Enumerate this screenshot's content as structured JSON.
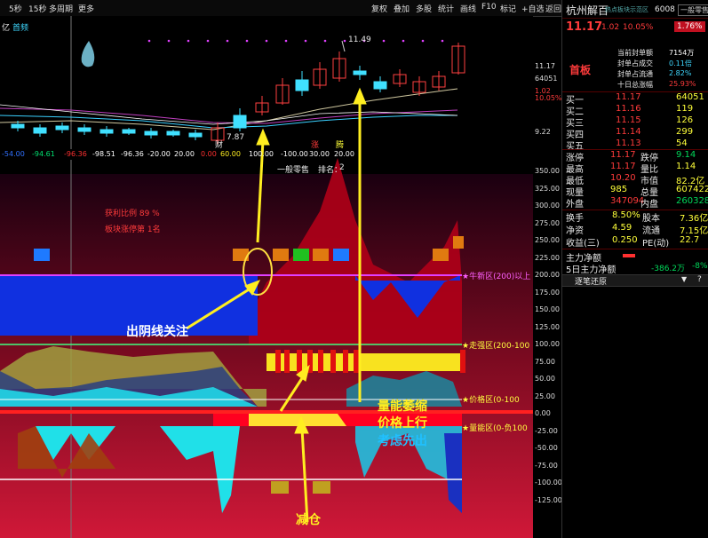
{
  "toolbar": {
    "left_items": [
      "5秒",
      "15秒",
      "多周期",
      "更多"
    ],
    "right_items": [
      "复权",
      "叠加",
      "多股",
      "统计",
      "画线",
      "F10",
      "标记",
      "+自选",
      "返回"
    ]
  },
  "chart_header": {
    "stock_unit": "亿",
    "label": "首频",
    "peak_price": "11.49",
    "low_price": "7.87",
    "markers": [
      "财",
      "涨",
      "腾"
    ]
  },
  "indicator_header": {
    "values": [
      "-54.00",
      "-94.61",
      "-96.36",
      "-98.51",
      "-96.36",
      "-20.00",
      "20.00",
      "0.00",
      "60.00",
      "100.00",
      "-100.00",
      "30.00",
      "20.00"
    ],
    "category": "一般零售",
    "rank_label": "排名：",
    "rank_value": "2"
  },
  "indicator_notes": [
    "获利比例 89 %",
    "板块涨停第 1名"
  ],
  "zone_labels": {
    "new_high": "★牛新区(200)以上",
    "strong": "★走强区(200-100",
    "price": "★价格区(0-100",
    "volume": "★量能区(0-负100"
  },
  "annotations": {
    "yin_line": "出阴线关注",
    "volume_shrink": "量能萎缩",
    "price_up": "价格上行",
    "consider_exit": "考虑先出",
    "reduce": "减仓"
  },
  "price_axis": [
    "11.17",
    "64051",
    "1.02",
    "10.05%",
    "9.22"
  ],
  "indicator_axis": [
    "350.00",
    "325.00",
    "300.00",
    "275.00",
    "250.00",
    "225.00",
    "200.00",
    "175.00",
    "150.00",
    "125.00",
    "100.00",
    "75.00",
    "50.00",
    "25.00",
    "0.00",
    "-25.00",
    "-50.00",
    "-75.00",
    "-100.00",
    "-125.00"
  ],
  "panel": {
    "title": "杭州解百",
    "title_sub": "热点板块示范区",
    "code": "6008",
    "industry": "一般零售",
    "price": "11.17",
    "change": "1.02",
    "change_pct": "10.05%",
    "badge_pct": "1.76%",
    "first_board": "首板",
    "seal_rows": [
      {
        "label": "当前封单额",
        "value": "7154万"
      },
      {
        "label": "封单占成交",
        "value": "0.11倍"
      },
      {
        "label": "封单占流通",
        "value": "2.82%"
      },
      {
        "label": "十日总涨幅",
        "value": "25.93%"
      }
    ],
    "bids": [
      {
        "label": "买一",
        "price": "11.17",
        "vol": "64051"
      },
      {
        "label": "买二",
        "price": "11.16",
        "vol": "119"
      },
      {
        "label": "买三",
        "price": "11.15",
        "vol": "126"
      },
      {
        "label": "买四",
        "price": "11.14",
        "vol": "299"
      },
      {
        "label": "买五",
        "price": "11.13",
        "vol": "54"
      }
    ],
    "stats": [
      {
        "l1": "涨停",
        "v1": "11.17",
        "l2": "跌停",
        "v2": "9.14"
      },
      {
        "l1": "最高",
        "v1": "11.17",
        "l2": "量比",
        "v2": "1.14"
      },
      {
        "l1": "最低",
        "v1": "10.20",
        "l2": "市值",
        "v2": "82.2亿"
      },
      {
        "l1": "现量",
        "v1": "985",
        "l2": "总量",
        "v2": "607422"
      },
      {
        "l1": "外盘",
        "v1": "347094",
        "l2": "内盘",
        "v2": "260328"
      }
    ],
    "stats2": [
      {
        "l1": "换手",
        "v1": "8.50%",
        "l2": "股本",
        "v2": "7.36亿"
      },
      {
        "l1": "净资",
        "v1": "4.59",
        "l2": "流通",
        "v2": "7.15亿"
      },
      {
        "l1": "收益(三)",
        "v1": "0.250",
        "l2": "PE(动)",
        "v2": "22.7"
      }
    ],
    "main_net_label": "主力净额",
    "main_net5_label": "5日主力净额",
    "main_net5_value": "-386.2万",
    "main_net5_pct": "-8%",
    "section_label": "逐笔还原",
    "section_btns": [
      "▼",
      "?"
    ]
  },
  "colors": {
    "up": "#ff3b3b",
    "down": "#00d85a",
    "accent": "#ffff3a"
  },
  "chart_data": {
    "type": "candlestick",
    "note_points": [
      "7.87",
      "11.49"
    ]
  }
}
